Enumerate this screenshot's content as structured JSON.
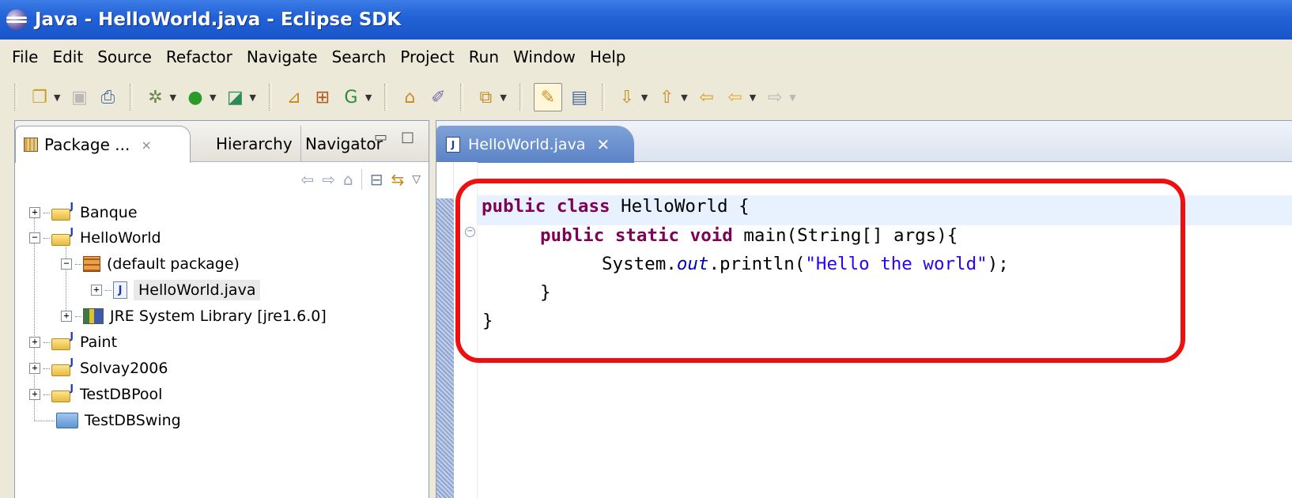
{
  "window": {
    "title": "Java - HelloWorld.java - Eclipse SDK",
    "icon": "eclipse-icon"
  },
  "menu": [
    "File",
    "Edit",
    "Source",
    "Refactor",
    "Navigate",
    "Search",
    "Project",
    "Run",
    "Window",
    "Help"
  ],
  "toolbar": {
    "icons": [
      "new-icon",
      "save-icon",
      "print-icon",
      "debug-icon",
      "run-icon",
      "external-tools-icon",
      "new-java-project-icon",
      "new-package-icon",
      "new-class-icon",
      "open-type-icon",
      "search-icon",
      "open-perspective-icon",
      "toggle-mark-occurrences-icon",
      "show-source-icon",
      "next-annotation-icon",
      "previous-annotation-icon",
      "last-edit-location-icon",
      "back-icon",
      "forward-icon"
    ]
  },
  "left_panel": {
    "tabs": {
      "package_explorer": "Package ...",
      "hierarchy": "Hierarchy",
      "navigator": "Navigator"
    },
    "tree": [
      {
        "label": "Banque",
        "type": "project",
        "expanded": false
      },
      {
        "label": "HelloWorld",
        "type": "project",
        "expanded": true
      },
      {
        "label": "(default package)",
        "type": "package",
        "expanded": true
      },
      {
        "label": "HelloWorld.java",
        "type": "java-file",
        "expanded": false,
        "selected": true
      },
      {
        "label": "JRE System Library [jre1.6.0]",
        "type": "library",
        "expanded": false
      },
      {
        "label": "Paint",
        "type": "project",
        "expanded": false
      },
      {
        "label": "Solvay2006",
        "type": "project",
        "expanded": false
      },
      {
        "label": "TestDBPool",
        "type": "project",
        "expanded": false
      },
      {
        "label": "TestDBSwing",
        "type": "folder",
        "expanded": false
      }
    ]
  },
  "editor": {
    "tab_label": "HelloWorld.java",
    "code": {
      "line1_kw": "public class",
      "line1_rest": " HelloWorld {",
      "line2_kw": "public static void",
      "line2_rest": " main(String[] args){",
      "line3_a": "System.",
      "line3_field": "out",
      "line3_b": ".println(",
      "line3_str": "\"Hello the world\"",
      "line3_c": ");",
      "line4": "}",
      "line5": "}"
    }
  },
  "colors": {
    "title_bar": "#2161d6",
    "keyword": "#7f0055",
    "string": "#2a00ff",
    "highlight_box": "#ee1010"
  }
}
